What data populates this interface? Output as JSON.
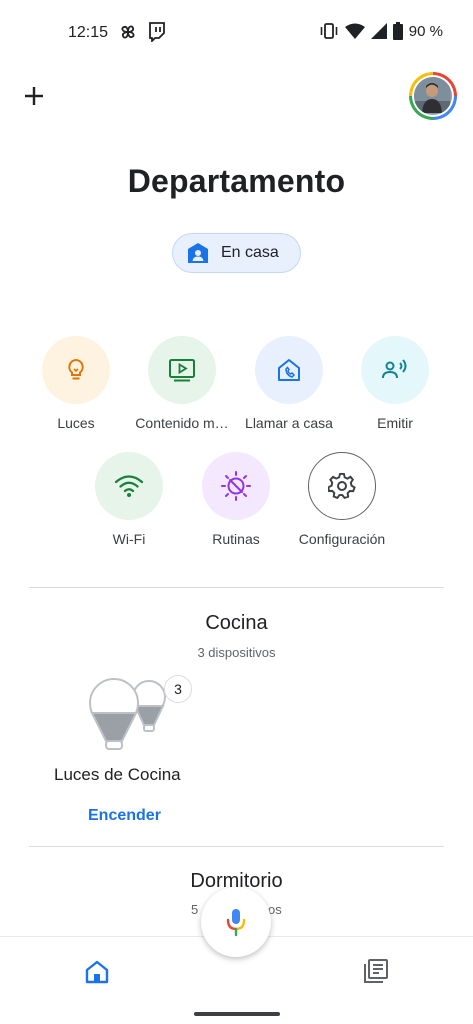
{
  "status_bar": {
    "time": "12:15",
    "battery": "90 %"
  },
  "home": {
    "title": "Departamento",
    "presence": "En casa"
  },
  "actions": [
    {
      "label": "Luces",
      "icon": "lightbulb-icon",
      "bg": "#fef3e0",
      "fg": "#e37400"
    },
    {
      "label": "Contenido m…",
      "icon": "media-play-icon",
      "bg": "#e6f4ea",
      "fg": "#188038"
    },
    {
      "label": "Llamar a casa",
      "icon": "home-call-icon",
      "bg": "#e8f0fe",
      "fg": "#1a73e8"
    },
    {
      "label": "Emitir",
      "icon": "cast-voice-icon",
      "bg": "#e4f7fb",
      "fg": "#12848f"
    },
    {
      "label": "Wi-Fi",
      "icon": "wifi-icon",
      "bg": "#e6f4ea",
      "fg": "#188038"
    },
    {
      "label": "Rutinas",
      "icon": "routines-icon",
      "bg": "#f3e8fd",
      "fg": "#9334e6"
    },
    {
      "label": "Configuración",
      "icon": "gear-icon",
      "bg": "#ffffff",
      "fg": "#3c4043"
    }
  ],
  "rooms": [
    {
      "name": "Cocina",
      "devices_count": "3 dispositivos",
      "group": {
        "name": "Luces de Cocina",
        "badge": "3",
        "action": "Encender"
      }
    },
    {
      "name": "Dormitorio",
      "devices_count_partial_left": "5",
      "devices_count_partial_right": "os"
    }
  ],
  "colors": {
    "accent": "#1a73e8"
  }
}
